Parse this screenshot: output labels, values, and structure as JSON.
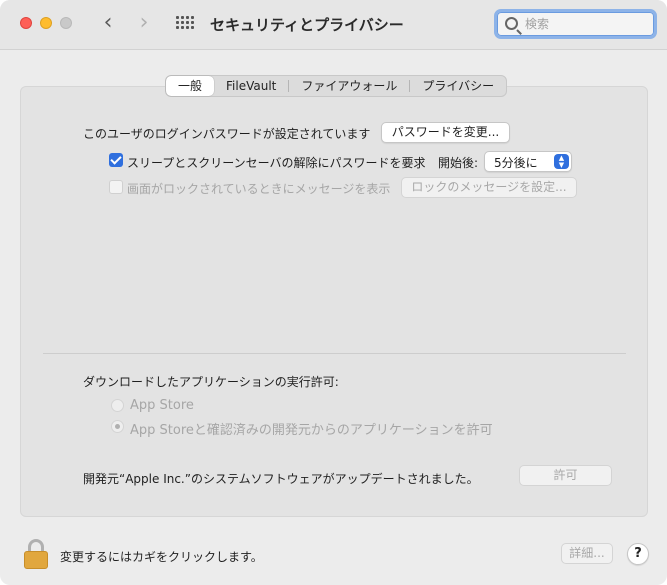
{
  "window": {
    "title": "セキュリティとプライバシー",
    "search": {
      "placeholder": "検索",
      "value": ""
    }
  },
  "tabs": [
    {
      "label": "一般",
      "active": true
    },
    {
      "label": "FileVault",
      "active": false
    },
    {
      "label": "ファイアウォール",
      "active": false
    },
    {
      "label": "プライバシー",
      "active": false
    }
  ],
  "general": {
    "password_set_text": "このユーザのログインパスワードが設定されています",
    "change_password_label": "パスワードを変更...",
    "require_password_label": "スリープとスクリーンセーバの解除にパスワードを要求",
    "require_password_checked": true,
    "after_label": "開始後:",
    "delay_value": "5分後に",
    "lock_message_label": "画面がロックされているときにメッセージを表示",
    "lock_message_checked": false,
    "set_lock_message_label": "ロックのメッセージを設定..."
  },
  "downloads": {
    "heading": "ダウンロードしたアプリケーションの実行許可:",
    "options": [
      {
        "label": "App Store",
        "selected": false
      },
      {
        "label": "App Storeと確認済みの開発元からのアプリケーションを許可",
        "selected": true
      }
    ],
    "system_software_text": "開発元“Apple Inc.”のシステムソフトウェアがアップデートされました。",
    "allow_label": "許可"
  },
  "footer": {
    "lock_text": "変更するにはカギをクリックします。",
    "advanced_label": "詳細...",
    "help_label": "?"
  },
  "colors": {
    "accent": "#2f6fde",
    "close": "#fe5f57",
    "minimize": "#febc2e",
    "lock": "#e1a73e"
  }
}
